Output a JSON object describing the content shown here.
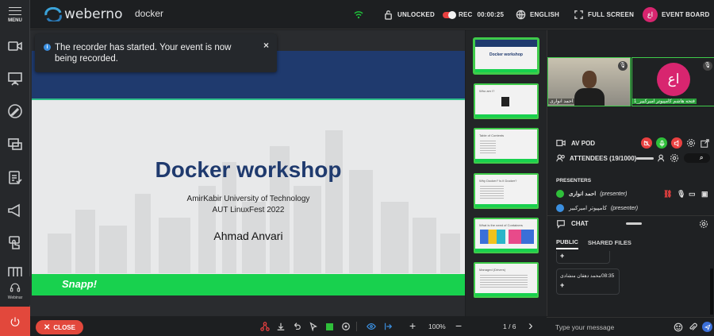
{
  "sidebar": {
    "menu_label": "MENU",
    "webinar_label": "Webinar"
  },
  "topbar": {
    "logo_text": "weberno",
    "room_name": "docker",
    "unlocked_label": "UNLOCKED",
    "rec_label": "REC",
    "rec_time": "00:00:25",
    "language_label": "ENGLISH",
    "fullscreen_label": "FULL SCREEN",
    "avatar_initials": "اع",
    "event_board_label": "EVENT BOARD"
  },
  "toast": {
    "message": "The recorder has started. Your event is now being recorded."
  },
  "slide": {
    "title": "Docker workshop",
    "line1": "AmirKabir University of Technology",
    "line2": "AUT LinuxFest 2022",
    "presenter": "Ahmad Anvari",
    "brand": "Snapp!"
  },
  "thumbnails": [
    {
      "title": "Docker workshop"
    },
    {
      "title": "Who am I?"
    },
    {
      "title": "Table of Contents"
    },
    {
      "title": "Why Docker? Is it Docker?"
    },
    {
      "title": "What is the need of Containers"
    },
    {
      "title": "Managed (Drivers)"
    }
  ],
  "video": {
    "presenter_name": "احمد انواری",
    "avatar_initials": "اع",
    "attendee_name": "فتحه هاشم کامپیوتر امیرکبیر_1"
  },
  "rightpanel": {
    "av_pod_label": "AV POD",
    "attendees_label": "ATTENDEES (19/1000)",
    "presenters_heading": "PRESENTERS",
    "presenter1_name": "احمد انواری",
    "presenter1_role": "(presenter)",
    "presenter2_name": "کامپیوتر امیرکبیر",
    "presenter2_role": "(presenter)",
    "chat_label": "CHAT",
    "public_tab": "PUBLIC",
    "shared_files_tab": "SHARED FILES",
    "chat_msg_sender": "محمد دهقان منشادی",
    "chat_msg_time": "08:35",
    "chat_msg_text": "+",
    "chat_prev_text": "+",
    "chat_placeholder": "Type your message"
  },
  "bottombar": {
    "close_label": "CLOSE",
    "zoom": "100%",
    "page": "1 / 6"
  },
  "colors": {
    "accent_green": "#18d14e",
    "navy": "#1f3a6e",
    "close_red": "#e2483c",
    "avatar_pink": "#d8256f",
    "rec_red": "#e94040"
  }
}
